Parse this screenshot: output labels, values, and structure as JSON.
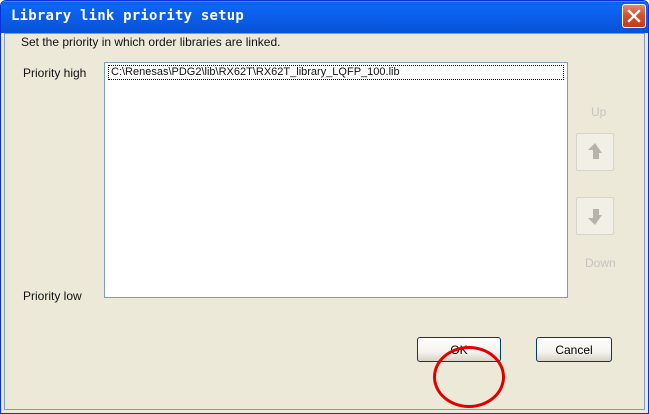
{
  "window": {
    "title": "Library link priority setup",
    "close_icon": "close-icon"
  },
  "dialog": {
    "instruction": "Set the priority in which order libraries are linked.",
    "priority_high": "Priority high",
    "priority_low": "Priority low",
    "libraries": [
      "C:\\Renesas\\PDG2\\lib\\RX62T\\RX62T_library_LQFP_100.lib"
    ],
    "up_label": "Up",
    "down_label": "Down",
    "up_icon": "up-arrow-icon",
    "down_icon": "down-arrow-icon"
  },
  "buttons": {
    "ok": "OK",
    "cancel": "Cancel"
  },
  "colors": {
    "titlebar": "#0752d5",
    "dialog_background": "#ece9d8",
    "disabled_text": "#c6c4bb",
    "annotation": "#e10000"
  },
  "annotation": {
    "target": "OK"
  }
}
